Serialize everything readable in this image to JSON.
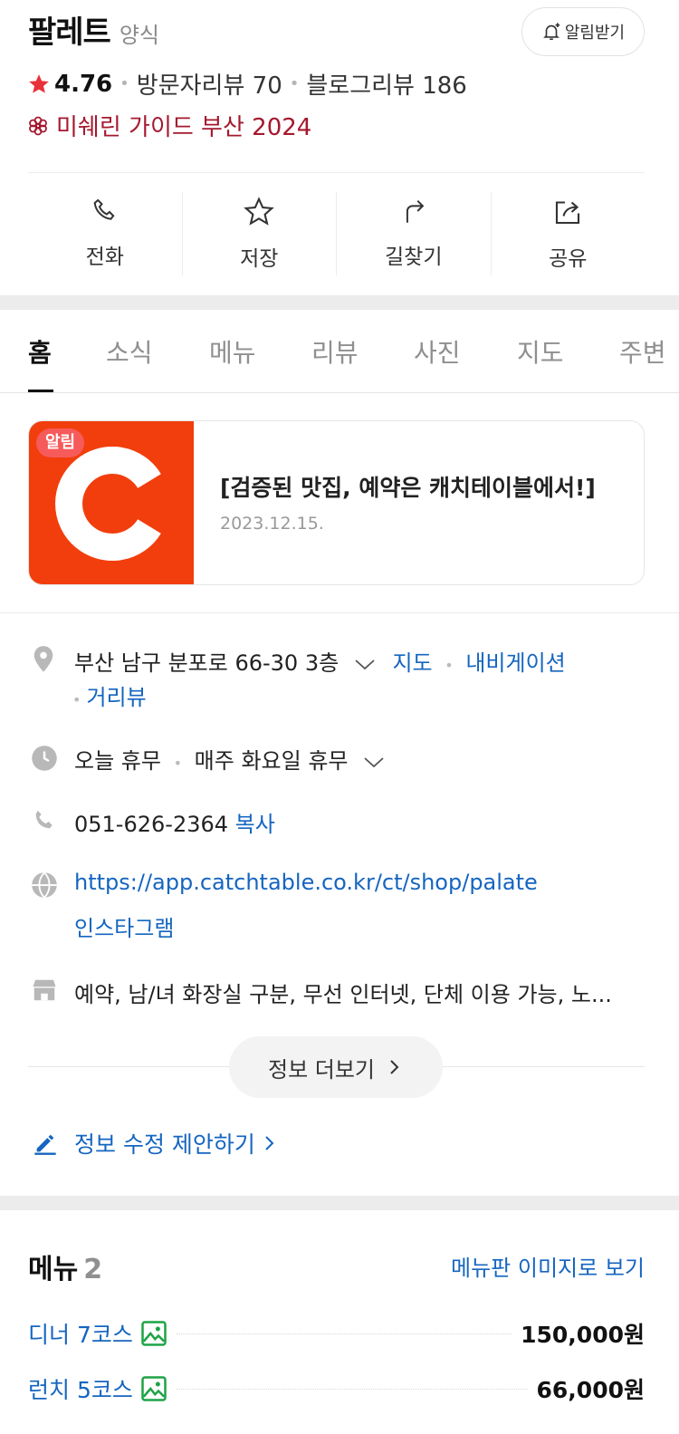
{
  "header": {
    "name": "팔레트",
    "category": "양식",
    "notify_label": "알림받기",
    "rating": "4.76",
    "visitor_reviews": "방문자리뷰 70",
    "blog_reviews": "블로그리뷰 186",
    "michelin": "미쉐린 가이드 부산 2024"
  },
  "actions": [
    {
      "label": "전화",
      "icon": "phone-icon"
    },
    {
      "label": "저장",
      "icon": "star-icon"
    },
    {
      "label": "길찾기",
      "icon": "directions-icon"
    },
    {
      "label": "공유",
      "icon": "share-icon"
    }
  ],
  "tabs": [
    "홈",
    "소식",
    "메뉴",
    "리뷰",
    "사진",
    "지도",
    "주변"
  ],
  "alert": {
    "badge": "알림",
    "title": "[검증된 맛집, 예약은 캐치테이블에서!]",
    "date": "2023.12.15."
  },
  "info": {
    "address": "부산 남구 분포로 66-30 3층",
    "address_links": [
      "지도",
      "내비게이션",
      "거리뷰"
    ],
    "hours_status": "오늘 휴무",
    "hours_detail": "매주 화요일 휴무",
    "phone": "051-626-2364",
    "copy_label": "복사",
    "website": "https://app.catchtable.co.kr/ct/shop/palate",
    "instagram": "인스타그램",
    "amenities": "예약, 남/녀 화장실 구분, 무선 인터넷, 단체 이용 가능, 노..."
  },
  "more_label": "정보 더보기",
  "edit_label": "정보 수정 제안하기",
  "menu": {
    "title": "메뉴",
    "count": "2",
    "view_label": "메뉴판 이미지로 보기",
    "items": [
      {
        "name": "디너 7코스",
        "price": "150,000원"
      },
      {
        "name": "런치 5코스",
        "price": "66,000원"
      }
    ]
  },
  "colors": {
    "accent_red": "#e8323a",
    "michelin": "#a5182e",
    "link_blue": "#1565c0",
    "catchtable_orange": "#f23e0c"
  }
}
